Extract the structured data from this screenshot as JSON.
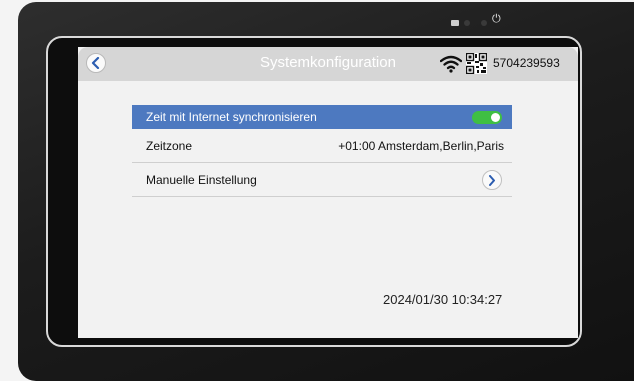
{
  "header": {
    "title": "Systemkonfiguration",
    "device_id": "5704239593",
    "icons": [
      "back-icon",
      "wifi-icon",
      "qr-code-icon"
    ]
  },
  "settings": {
    "sync_label": "Zeit mit Internet synchronisieren",
    "sync_enabled": true,
    "timezone_label": "Zeitzone",
    "timezone_value": "+01:00 Amsterdam,Berlin,Paris",
    "manual_label": "Manuelle Einstellung"
  },
  "status": {
    "datetime": "2024/01/30 10:34:27"
  },
  "colors": {
    "active_row": "#4d79c0",
    "toggle_on": "#3fbf43",
    "topbar": "#d6d6d6",
    "bezel": "#1c1c1c"
  }
}
